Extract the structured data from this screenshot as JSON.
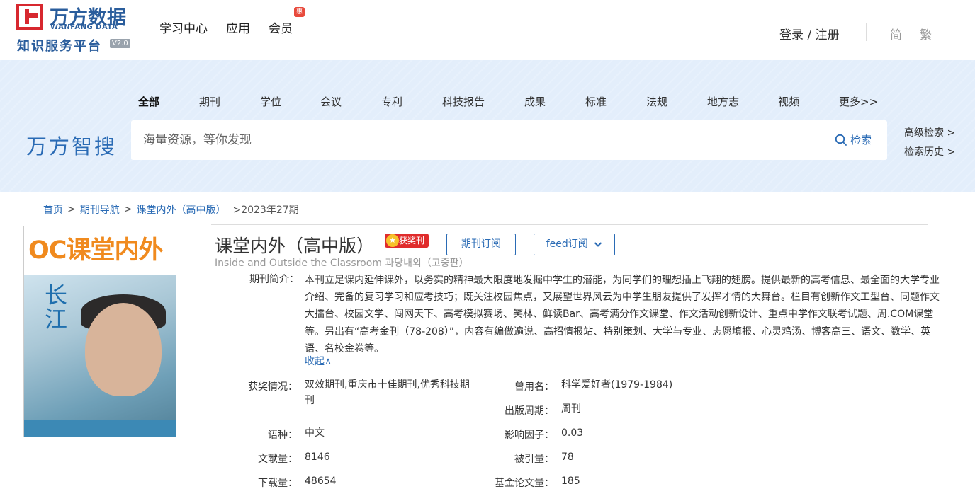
{
  "header": {
    "logo_cn": "万方数据",
    "logo_en": "WANFANG DATA",
    "logo_sub": "知识服务平台",
    "logo_version": "V2.0",
    "nav": [
      "学习中心",
      "应用",
      "会员"
    ],
    "member_badge": "惠",
    "login": "登录 / 注册",
    "lang_simplified": "简",
    "lang_traditional": "繁"
  },
  "search": {
    "categories": [
      "全部",
      "期刊",
      "学位",
      "会议",
      "专利",
      "科技报告",
      "成果",
      "标准",
      "法规",
      "地方志",
      "视频",
      "更多>>"
    ],
    "brand": "万方智搜",
    "placeholder": "海量资源，等你发现",
    "button": "检索",
    "advanced": "高级检索 >",
    "history": "检索历史 >"
  },
  "breadcrumb": {
    "home": "首页",
    "nav": "期刊导航",
    "journal": "课堂内外（高中版）",
    "current": ">2023年27期"
  },
  "cover": {
    "title": "OC课堂内外",
    "slogan": "长江"
  },
  "journal": {
    "title": "课堂内外（高中版）",
    "award_badge": "获奖刊",
    "subscribe_button": "期刊订阅",
    "feed_button": "feed订阅",
    "subtitle": "Inside and Outside the Classroom 과당내외（고중판）",
    "intro_label": "期刊简介：",
    "intro": "本刊立足课内延伸课外，以务实的精神最大限度地发掘中学生的潜能，为同学们的理想插上飞翔的翅膀。提供最新的高考信息、最全面的大学专业介绍、完备的复习学习和应考技巧；既关注校园焦点，又展望世界风云为中学生朋友提供了发挥才情的大舞台。栏目有创新作文工型台、同题作文大擂台、校园文学、闯网天下、高考模拟赛场、笑林、鲜读Bar、高考满分作文课堂、作文活动创新设计、重点中学作文联考试题、周.COM课堂等。另出有“高考金刊（78-208）”，内容有编做遍说、高招情报站、特别策划、大学与专业、志愿填报、心灵鸡汤、博客高三、语文、数学、英语、名校金卷等。",
    "collapse": "收起∧",
    "fields": {
      "awards_label": "获奖情况：",
      "awards": "双效期刊,重庆市十佳期刊,优秀科技期刊",
      "former_name_label": "曾用名：",
      "former_name": "科学爱好者(1979-1984)",
      "cycle_label": "出版周期：",
      "cycle": "周刊",
      "language_label": "语种：",
      "language": "中文",
      "impact_label": "影响因子：",
      "impact": "0.03",
      "docs_label": "文献量：",
      "docs": "8146",
      "cited_label": "被引量：",
      "cited": "78",
      "downloads_label": "下载量：",
      "downloads": "48654",
      "fund_label": "基金论文量：",
      "fund": "185"
    }
  },
  "colors": {
    "brand_blue": "#2a6bb5",
    "logo_red": "#d7282f",
    "banner_bg": "#e3eefb",
    "award_red": "#e02c2c"
  }
}
